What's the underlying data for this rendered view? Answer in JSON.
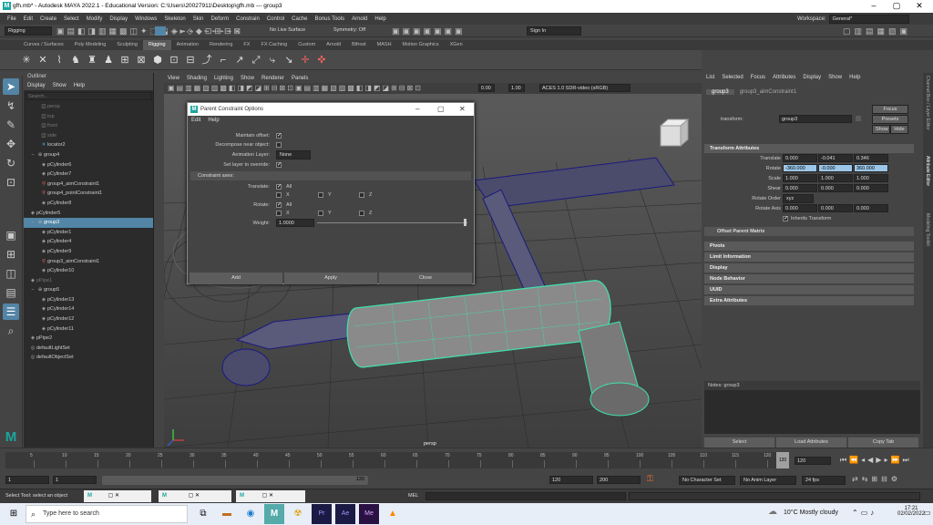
{
  "window": {
    "title": "gfh.mb* - Autodesk MAYA 2022.1 - Educational Version: C:\\Users\\20027911\\Desktop\\gfh.mb  ---  group3",
    "logo": "M"
  },
  "menubar": [
    "File",
    "Edit",
    "Create",
    "Select",
    "Modify",
    "Display",
    "Windows",
    "Skeleton",
    "Skin",
    "Deform",
    "Constrain",
    "Control",
    "Cache",
    "Bonus Tools",
    "Arnold",
    "Help"
  ],
  "workspace": {
    "label": "Workspace:",
    "value": "General*"
  },
  "statusline": {
    "menuset": "Rigging",
    "live_surface": "No Live Surface",
    "symmetry": "Symmetry: Off",
    "signin": "Sign In"
  },
  "shelf_tabs": [
    "Curves / Surfaces",
    "Poly Modeling",
    "Sculpting",
    "Rigging",
    "Animation",
    "Rendering",
    "FX",
    "FX Caching",
    "Custom",
    "Arnold",
    "Bifrost",
    "MASH",
    "Motion Graphics",
    "XGen"
  ],
  "shelf_active": "Rigging",
  "outliner": {
    "title": "Outliner",
    "menus": [
      "Display",
      "Show",
      "Help"
    ],
    "search_placeholder": "Search...",
    "items": [
      {
        "label": "persp",
        "indent": 1,
        "style": "dim",
        "icon": "camera-icon"
      },
      {
        "label": "top",
        "indent": 1,
        "style": "dim",
        "icon": "camera-icon"
      },
      {
        "label": "front",
        "indent": 1,
        "style": "dim",
        "icon": "camera-icon"
      },
      {
        "label": "side",
        "indent": 1,
        "style": "dim",
        "icon": "camera-icon"
      },
      {
        "label": "locator2",
        "indent": 1,
        "style": "",
        "icon": "locator-icon"
      },
      {
        "label": "group4",
        "indent": 0,
        "style": "",
        "icon": "group-icon"
      },
      {
        "label": "pCylinder6",
        "indent": 1,
        "style": "",
        "icon": "mesh-icon"
      },
      {
        "label": "pCylinder7",
        "indent": 1,
        "style": "",
        "icon": "mesh-icon"
      },
      {
        "label": "group4_aimConstraint1",
        "indent": 1,
        "style": "",
        "icon": "constraint-icon"
      },
      {
        "label": "group4_pointConstraint1",
        "indent": 1,
        "style": "",
        "icon": "constraint-icon"
      },
      {
        "label": "pCylinder8",
        "indent": 1,
        "style": "",
        "icon": "mesh-icon"
      },
      {
        "label": "pCylinder5",
        "indent": 0,
        "style": "",
        "icon": "mesh-icon"
      },
      {
        "label": "group3",
        "indent": 0,
        "style": "sel",
        "icon": "group-icon"
      },
      {
        "label": "pCylinder1",
        "indent": 1,
        "style": "",
        "icon": "mesh-icon"
      },
      {
        "label": "pCylinder4",
        "indent": 1,
        "style": "",
        "icon": "mesh-icon"
      },
      {
        "label": "pCylinder9",
        "indent": 1,
        "style": "",
        "icon": "mesh-icon"
      },
      {
        "label": "group3_aimConstraint1",
        "indent": 1,
        "style": "",
        "icon": "constraint-icon"
      },
      {
        "label": "pCylinder10",
        "indent": 1,
        "style": "",
        "icon": "mesh-icon"
      },
      {
        "label": "pPipe1",
        "indent": 0,
        "style": "dim",
        "icon": "mesh-icon"
      },
      {
        "label": "group5",
        "indent": 0,
        "style": "",
        "icon": "group-icon"
      },
      {
        "label": "pCylinder13",
        "indent": 1,
        "style": "",
        "icon": "mesh-icon"
      },
      {
        "label": "pCylinder14",
        "indent": 1,
        "style": "",
        "icon": "mesh-icon"
      },
      {
        "label": "pCylinder12",
        "indent": 1,
        "style": "",
        "icon": "mesh-icon"
      },
      {
        "label": "pCylinder11",
        "indent": 1,
        "style": "",
        "icon": "mesh-icon"
      },
      {
        "label": "pPipe2",
        "indent": 0,
        "style": "",
        "icon": "mesh-icon"
      },
      {
        "label": "defaultLightSet",
        "indent": 0,
        "style": "",
        "icon": "set-icon"
      },
      {
        "label": "defaultObjectSet",
        "indent": 0,
        "style": "",
        "icon": "set-icon"
      }
    ]
  },
  "viewport": {
    "menus": [
      "View",
      "Shading",
      "Lighting",
      "Show",
      "Renderer",
      "Panels"
    ],
    "exposure": "0.00",
    "gamma": "1.00",
    "colorspace": "ACES 1.0 SDR-video (sRGB)",
    "camera_label": "persp"
  },
  "dialog": {
    "title": "Parent Constraint Options",
    "menus": [
      "Edit",
      "Help"
    ],
    "maintain_offset": "Maintain offset:",
    "decompose": "Decompose near object:",
    "anim_layer": "Animation Layer:",
    "anim_layer_value": "None",
    "set_layer": "Set layer to override:",
    "section": "Constraint axes:",
    "translate": "Translate:",
    "rotate": "Rotate:",
    "all": "All",
    "x": "X",
    "y": "Y",
    "z": "Z",
    "weight": "Weight:",
    "weight_value": "1.0000",
    "buttons": {
      "add": "Add",
      "apply": "Apply",
      "close": "Close"
    }
  },
  "attr_editor": {
    "menus": [
      "List",
      "Selected",
      "Focus",
      "Attributes",
      "Display",
      "Show",
      "Help"
    ],
    "tabs": [
      "group3",
      "group3_aimConstraint1"
    ],
    "transform_label": "transform:",
    "transform_value": "group3",
    "focus": "Focus",
    "presets": "Presets",
    "show": "Show",
    "hide": "Hide",
    "section_transform": "Transform Attributes",
    "rows": [
      {
        "label": "Translate",
        "v": [
          "0.000",
          "-0.041",
          "0.346"
        ]
      },
      {
        "label": "Rotate",
        "v": [
          "-360.000",
          "-0.000",
          "360.000"
        ]
      },
      {
        "label": "Scale",
        "v": [
          "1.000",
          "1.000",
          "1.000"
        ]
      },
      {
        "label": "Shear",
        "v": [
          "0.000",
          "0.000",
          "0.000"
        ]
      }
    ],
    "rotate_order_label": "Rotate Order",
    "rotate_order": "xyz",
    "rotate_axis_label": "Rotate Axis",
    "rotate_axis": [
      "0.000",
      "0.000",
      "0.000"
    ],
    "inherits": "Inherits Transform",
    "sections": [
      "Offset Parent Matrix",
      "Pivots",
      "Limit Information",
      "Display",
      "Node Behavior",
      "UUID",
      "Extra Attributes"
    ],
    "notes": "Notes:  group3",
    "bottom_buttons": [
      "Select",
      "Load Attributes",
      "Copy Tab"
    ]
  },
  "side_tabs": [
    "Channel Box / Layer Editor",
    "Attribute Editor",
    "Modeling Toolkit"
  ],
  "timeline": {
    "ticks": [
      "5",
      "10",
      "15",
      "20",
      "25",
      "30",
      "35",
      "40",
      "45",
      "50",
      "55",
      "60",
      "65",
      "70",
      "75",
      "80",
      "85",
      "90",
      "95",
      "100",
      "105",
      "110",
      "115",
      "120"
    ],
    "current_frame": "120",
    "range_start": "1",
    "range_start2": "1",
    "range_inner_end": "120",
    "range_end": "120",
    "range_end2": "200",
    "character_set": "No Character Set",
    "anim_layer": "No Anim Layer",
    "fps": "24 fps"
  },
  "cmdline": {
    "mel": "MEL",
    "help": "Select Tool: select an object"
  },
  "taskbar": {
    "search": "Type here to search",
    "weather": "10°C  Mostly cloudy",
    "time": "17:21",
    "date": "02/02/2022"
  }
}
